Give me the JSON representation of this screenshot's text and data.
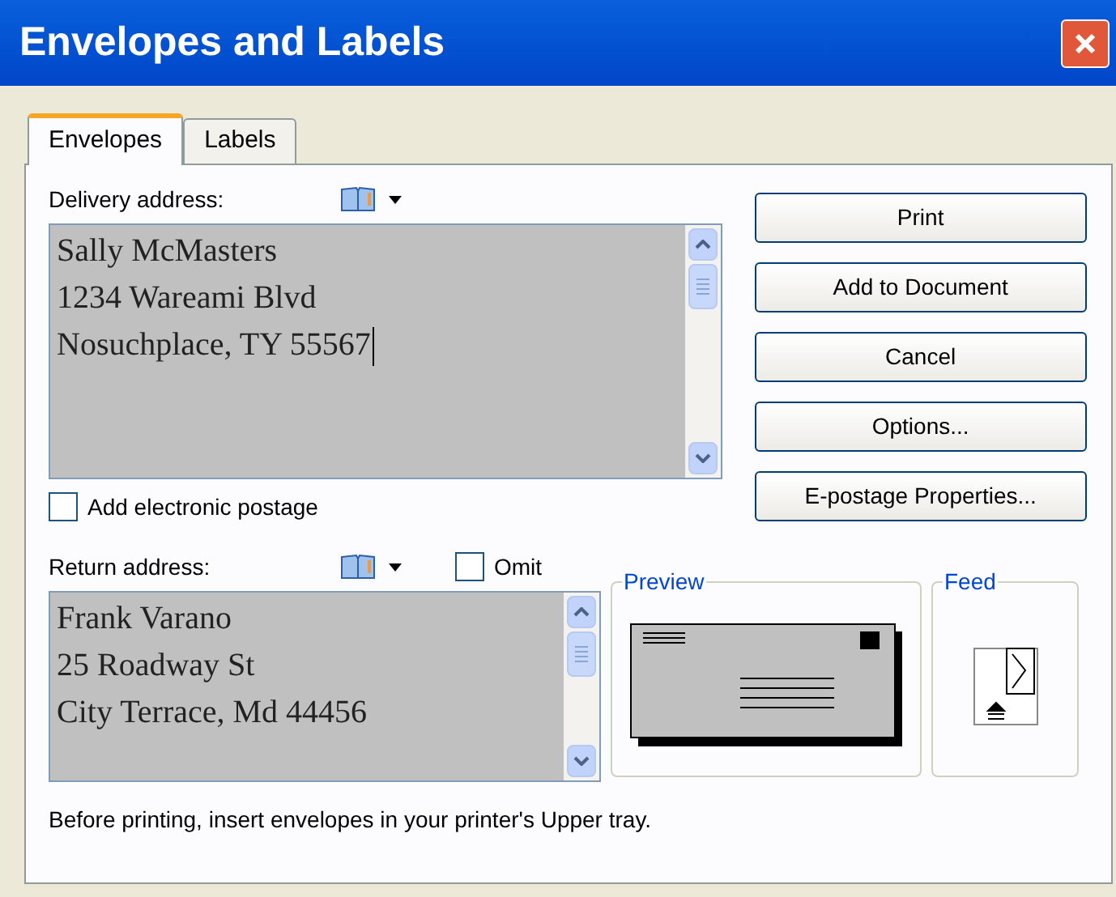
{
  "window": {
    "title": "Envelopes and Labels"
  },
  "tabs": [
    {
      "label": "Envelopes",
      "selected": true
    },
    {
      "label": "Labels",
      "selected": false
    }
  ],
  "delivery": {
    "label": "Delivery address:",
    "lines": [
      "Sally McMasters",
      "1234 Wareami Blvd",
      "Nosuchplace, TY 55567"
    ]
  },
  "electronic_postage": {
    "label": "Add electronic postage",
    "checked": false
  },
  "return": {
    "label": "Return address:",
    "omit": {
      "label": "Omit",
      "checked": false
    },
    "lines": [
      "Frank Varano",
      "25 Roadway St",
      "City Terrace, Md 44456"
    ]
  },
  "preview": {
    "title": "Preview"
  },
  "feed": {
    "title": "Feed"
  },
  "buttons": [
    "Print",
    "Add to Document",
    "Cancel",
    "Options...",
    "E-postage Properties..."
  ],
  "status": "Before printing, insert envelopes in your printer's Upper tray."
}
